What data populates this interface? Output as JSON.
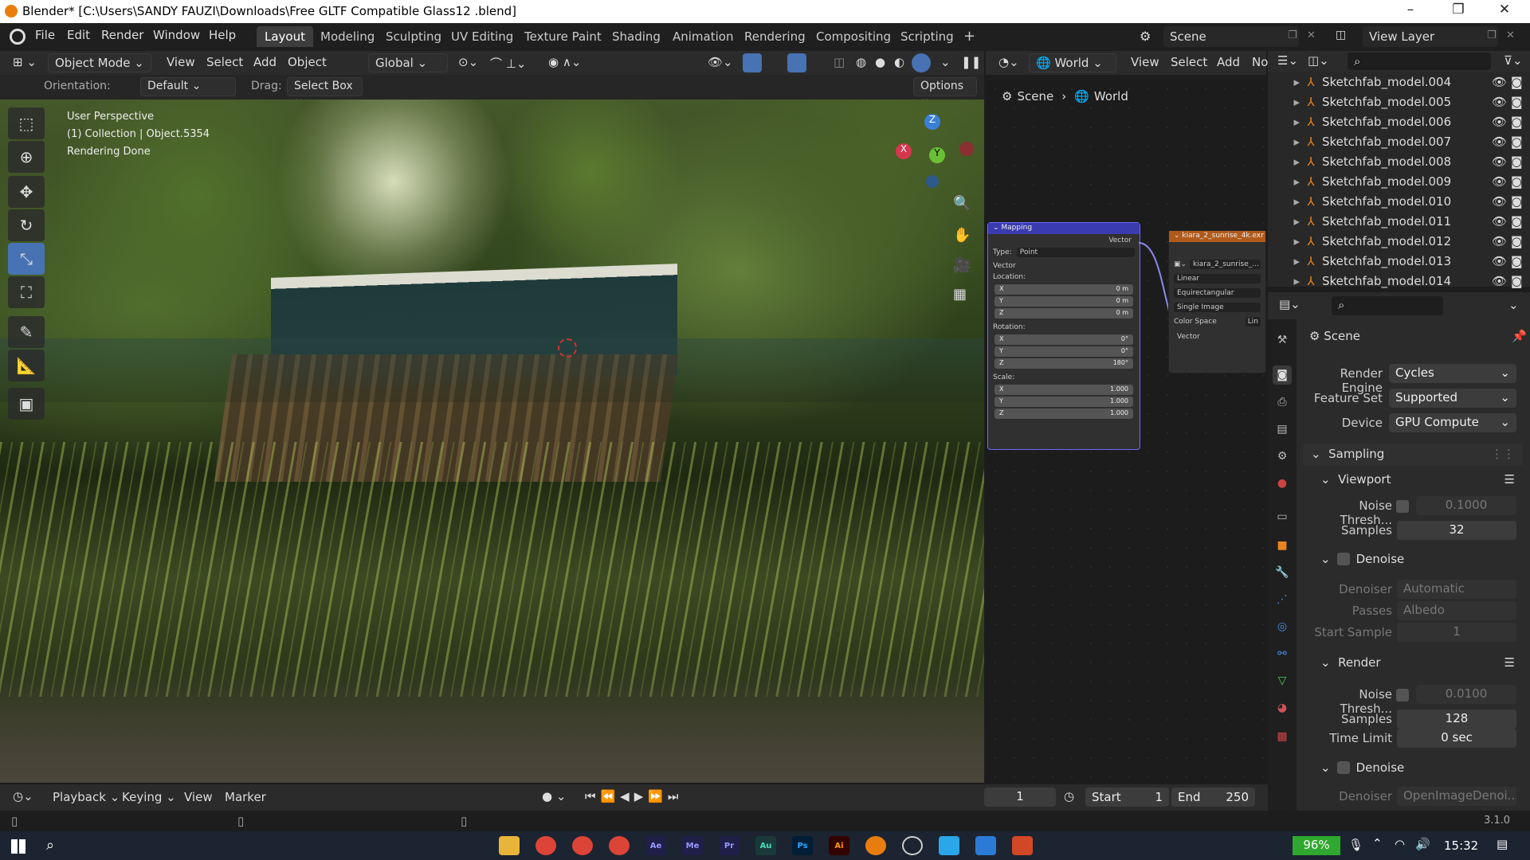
{
  "window": {
    "title": "Blender* [C:\\Users\\SANDY FAUZI\\Downloads\\Free GLTF Compatible Glass12 .blend]",
    "minimize": "–",
    "maximize": "❐",
    "close": "✕"
  },
  "menu": {
    "items": [
      "File",
      "Edit",
      "Render",
      "Window",
      "Help"
    ]
  },
  "workspaces": {
    "tabs": [
      "Layout",
      "Modeling",
      "Sculpting",
      "UV Editing",
      "Texture Paint",
      "Shading",
      "Animation",
      "Rendering",
      "Compositing",
      "Scripting"
    ],
    "add": "+"
  },
  "scene_selector": {
    "label": "Scene",
    "view_layer": "View Layer"
  },
  "viewport_header": {
    "mode": "Object Mode",
    "view": "View",
    "select": "Select",
    "add": "Add",
    "object": "Object",
    "transform": "Global"
  },
  "tool_settings": {
    "orientation_label": "Orientation:",
    "orientation": "Default",
    "drag_label": "Drag:",
    "drag": "Select Box",
    "options": "Options"
  },
  "viewport_info": {
    "line1": "User Perspective",
    "line2": "(1) Collection | Object.5354",
    "line3": "Rendering Done"
  },
  "gizmo": {
    "x": "X",
    "y": "Y",
    "z": "Z"
  },
  "node_header": {
    "world": "World",
    "view": "View",
    "select": "Select",
    "add": "Add",
    "node": "No"
  },
  "breadcrumb": {
    "scene": "Scene",
    "world": "World"
  },
  "mapping_node": {
    "title": "Mapping",
    "output": "Vector",
    "type_label": "Type:",
    "type": "Point",
    "vector_label": "Vector",
    "location_label": "Location:",
    "loc_x": "0 m",
    "loc_y": "0 m",
    "loc_z": "0 m",
    "rotation_label": "Rotation:",
    "rot_x": "0°",
    "rot_y": "0°",
    "rot_z": "180°",
    "scale_label": "Scale:",
    "scl_x": "1.000",
    "scl_y": "1.000",
    "scl_z": "1.000",
    "ax_x": "X",
    "ax_y": "Y",
    "ax_z": "Z"
  },
  "image_node": {
    "title": "kiara_2_sunrise_4k.exr",
    "image": "kiara_2_sunrise_...",
    "interp": "Linear",
    "projection": "Equirectangular",
    "source": "Single Image",
    "colorspace_label": "Color Space",
    "colorspace": "Lin",
    "input": "Vector"
  },
  "outliner": {
    "items": [
      "Sketchfab_model.004",
      "Sketchfab_model.005",
      "Sketchfab_model.006",
      "Sketchfab_model.007",
      "Sketchfab_model.008",
      "Sketchfab_model.009",
      "Sketchfab_model.010",
      "Sketchfab_model.011",
      "Sketchfab_model.012",
      "Sketchfab_model.013",
      "Sketchfab_model.014"
    ]
  },
  "properties": {
    "context": "Scene",
    "render_engine_label": "Render Engine",
    "render_engine": "Cycles",
    "feature_set_label": "Feature Set",
    "feature_set": "Supported",
    "device_label": "Device",
    "device": "GPU Compute",
    "sampling": "Sampling",
    "viewport": "Viewport",
    "noise_label": "Noise Thresh...",
    "vp_noise": "0.1000",
    "samples_label": "Samples",
    "vp_samples": "32",
    "denoise": "Denoise",
    "denoiser_label": "Denoiser",
    "vp_denoiser": "Automatic",
    "passes_label": "Passes",
    "vp_passes": "Albedo",
    "start_sample_label": "Start Sample",
    "vp_start": "1",
    "render": "Render",
    "r_noise": "0.0100",
    "r_samples": "128",
    "time_limit_label": "Time Limit",
    "r_time": "0 sec",
    "r_denoiser": "OpenImageDenoi..."
  },
  "timeline": {
    "playback": "Playback",
    "keying": "Keying",
    "view": "View",
    "marker": "Marker",
    "frame": "1",
    "start_label": "Start",
    "start": "1",
    "end_label": "End",
    "end": "250"
  },
  "status": {
    "version": "3.1.0"
  },
  "taskbar": {
    "apps": [
      "Ae",
      "Me",
      "Pr",
      "Au",
      "Ps",
      "Ai"
    ],
    "battery": "96%",
    "time": "15:32"
  }
}
